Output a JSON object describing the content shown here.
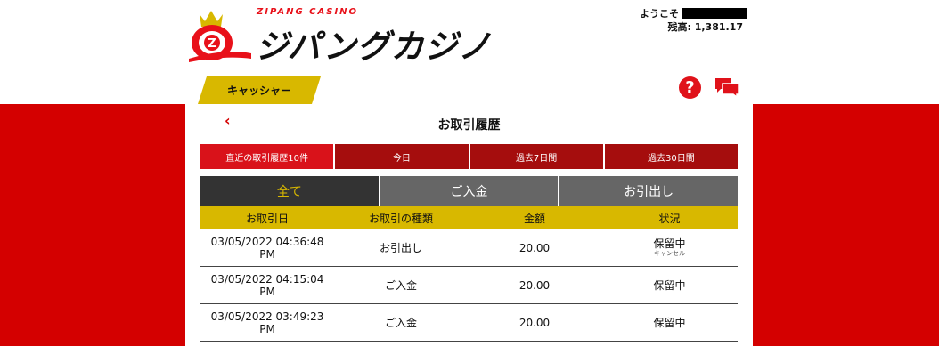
{
  "header": {
    "logo_sub": "ZIPANG CASINO",
    "logo_main": "ジパングカジノ",
    "welcome_label": "ようこそ",
    "balance": "残高: 1,381.17",
    "cashier_tab": "キャッシャー"
  },
  "colors": {
    "red_band": "#d40000",
    "accent_yellow": "#d8b800",
    "dark_red_tab": "#a50d0d",
    "active_red_tab": "#d9121a"
  },
  "icons": {
    "help": "question-circle-icon",
    "chat": "chat-bubbles-icon",
    "back": "chevron-left-icon"
  },
  "panel": {
    "back_label": "‹",
    "title": "お取引履歴",
    "periods": [
      {
        "label": "直近の取引履歴10件",
        "active": true
      },
      {
        "label": "今日",
        "active": false
      },
      {
        "label": "過去7日間",
        "active": false
      },
      {
        "label": "過去30日間",
        "active": false
      }
    ],
    "types": [
      {
        "label": "全て",
        "active": true
      },
      {
        "label": "ご入金",
        "active": false
      },
      {
        "label": "お引出し",
        "active": false
      }
    ],
    "columns": [
      "お取引日",
      "お取引の種類",
      "金額",
      "状況"
    ],
    "rows": [
      {
        "date": "03/05/2022 04:36:48",
        "time": "PM",
        "type": "お引出し",
        "amount": "20.00",
        "status": "保留中",
        "sub": "キャンセル"
      },
      {
        "date": "03/05/2022 04:15:04",
        "time": "PM",
        "type": "ご入金",
        "amount": "20.00",
        "status": "保留中",
        "sub": ""
      },
      {
        "date": "03/05/2022 03:49:23",
        "time": "PM",
        "type": "ご入金",
        "amount": "20.00",
        "status": "保留中",
        "sub": ""
      }
    ]
  }
}
